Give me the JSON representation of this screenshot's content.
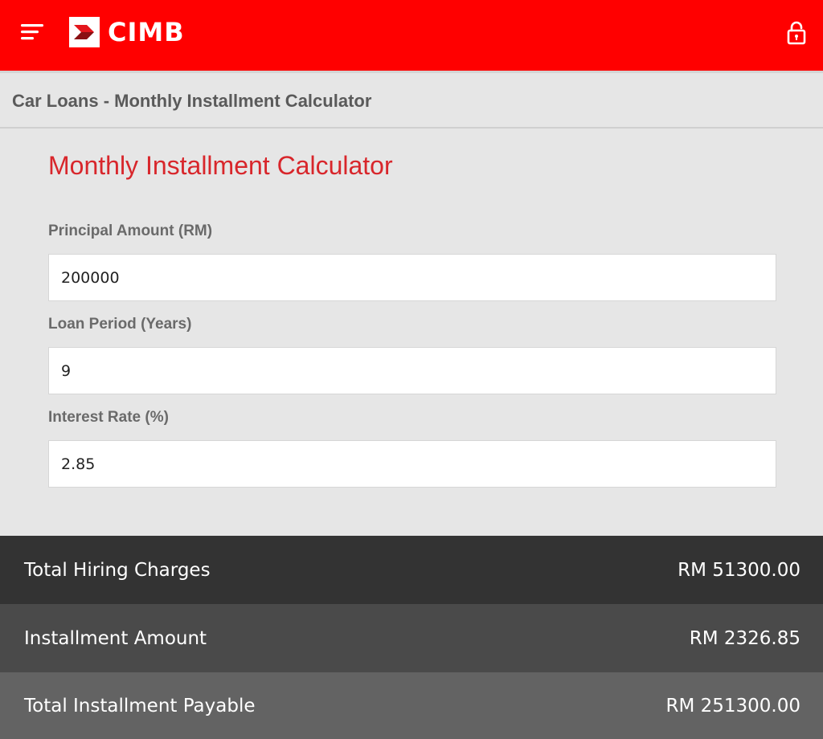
{
  "header": {
    "brand": "CIMB",
    "brand_color": "#ff0000",
    "menu_icon": "hamburger-menu-icon",
    "lock_icon": "lock-icon"
  },
  "breadcrumb": {
    "title": "Car Loans - Monthly Installment Calculator"
  },
  "calculator": {
    "heading": "Monthly Installment Calculator",
    "heading_color": "#d8262b",
    "principal_label": "Principal Amount (RM)",
    "principal_value": "200000",
    "period_label": "Loan Period (Years)",
    "period_value": "9",
    "rate_label": "Interest Rate (%)",
    "rate_value": "2.85"
  },
  "results": {
    "hiring_label": "Total Hiring Charges",
    "hiring_value": "RM 51300.00",
    "installment_label": "Installment Amount",
    "installment_value": "RM 2326.85",
    "payable_label": "Total Installment Payable",
    "payable_value": "RM 251300.00"
  }
}
